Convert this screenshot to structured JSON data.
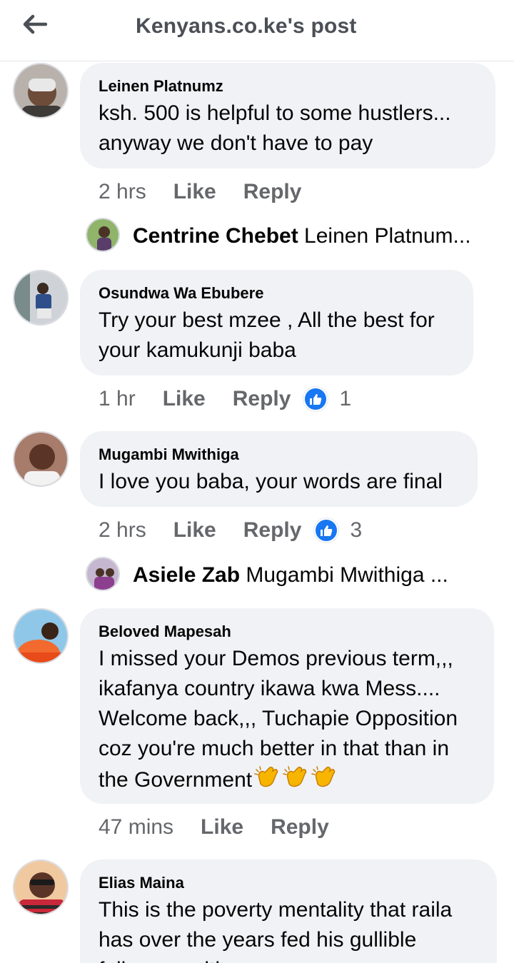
{
  "header": {
    "title": "Kenyans.co.ke's post"
  },
  "comments": [
    {
      "author": "Leinen Platnumz",
      "lines": [
        "ksh. 500 is helpful to some hustlers...",
        "anyway we don't have to pay"
      ],
      "time": "2 hrs",
      "like": "Like",
      "reply": "Reply"
    },
    {
      "author": "Osundwa Wa Ebubere",
      "lines": [
        "Try your best mzee , All the best for",
        "your kamukunji baba"
      ],
      "time": "1 hr",
      "like": "Like",
      "reply": "Reply",
      "reactions": "1"
    },
    {
      "author": "Mugambi Mwithiga",
      "lines": [
        "I love you baba, your words are final"
      ],
      "time": "2 hrs",
      "like": "Like",
      "reply": "Reply",
      "reactions": "3"
    },
    {
      "author": "Beloved Mapesah",
      "lines": [
        "I missed your Demos previous term,,,",
        "ikafanya country ikawa kwa Mess....",
        "Welcome back,,, Tuchapie Opposition",
        "coz you're much better in that than in",
        "the Government"
      ],
      "time": "47 mins",
      "like": "Like",
      "reply": "Reply"
    },
    {
      "author": "Elias Maina",
      "lines": [
        "This is the poverty mentality that raila",
        "has over the years fed his gullible",
        "followers with"
      ]
    }
  ],
  "replies": [
    {
      "author": "Centrine Chebet",
      "text": "Leinen Platnum..."
    },
    {
      "author": "Asiele Zab",
      "text": "Mugambi Mwithiga ..."
    }
  ],
  "colors": {
    "accent": "#1877f2",
    "bubble": "#f0f2f5",
    "muted": "#65676b"
  },
  "icons": {
    "back": "arrow-left-icon",
    "reaction": "thumbs-up-icon",
    "emoji": "clapping-hands-emoji"
  }
}
